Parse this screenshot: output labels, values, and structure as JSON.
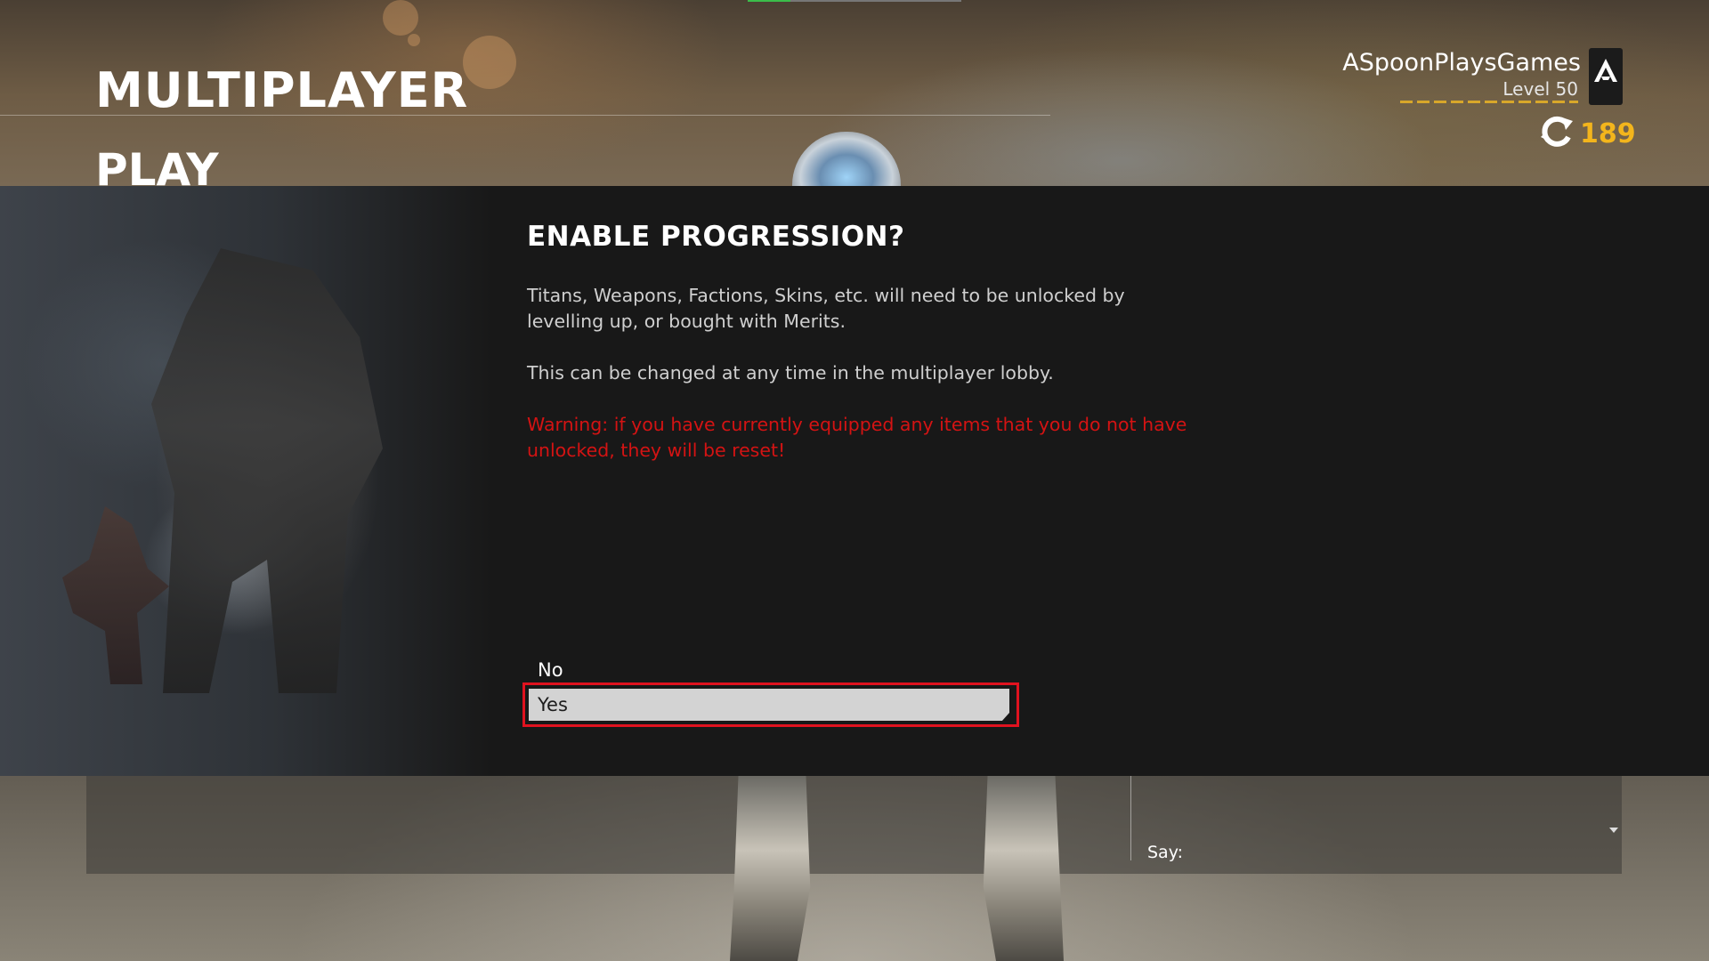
{
  "header": {
    "title": "MULTIPLAYER",
    "subtitle": "PLAY"
  },
  "player": {
    "name": "ASpoonPlaysGames",
    "level": "Level 50",
    "merits": "189",
    "rank_icon": "titanfall-a-logo-icon",
    "merits_icon": "merit-refresh-icon"
  },
  "dialog": {
    "title": "ENABLE PROGRESSION?",
    "body_1": "Titans, Weapons, Factions, Skins, etc. will need to be unlocked by levelling up, or bought with Merits.",
    "body_2": "This can be changed at any time in the multiplayer lobby.",
    "warning": "Warning: if you have currently equipped any items that you do not have unlocked, they will be reset!",
    "options": [
      {
        "label": "No",
        "selected": false
      },
      {
        "label": "Yes",
        "selected": true
      }
    ]
  },
  "chat": {
    "say_label": "Say:"
  },
  "colors": {
    "accent_gold": "#f3b51c",
    "warning_red": "#d41313",
    "selection_border": "#e0121f",
    "dialog_bg": "#181818"
  }
}
